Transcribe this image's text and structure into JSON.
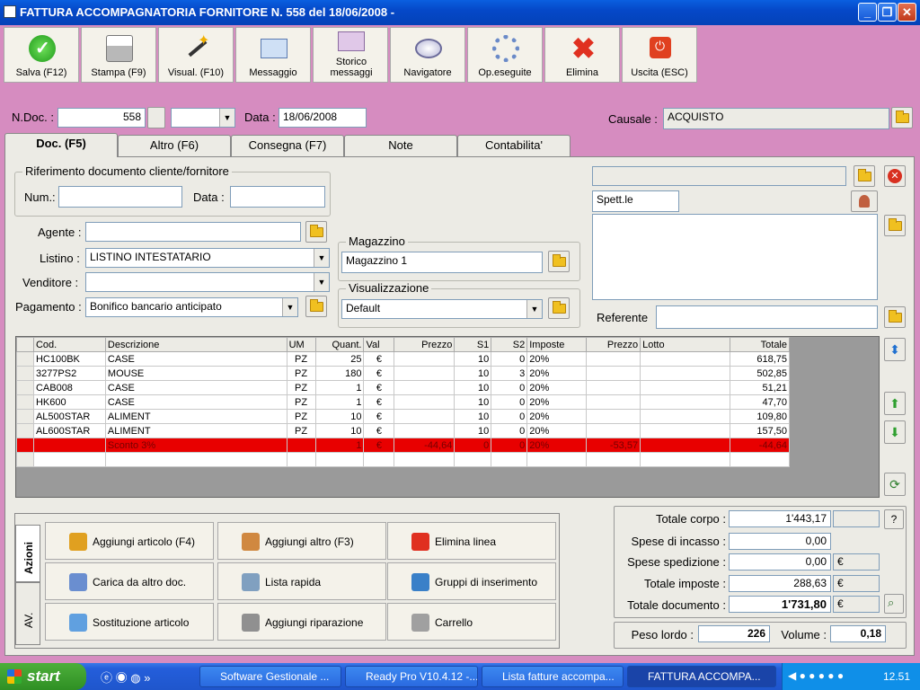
{
  "window": {
    "title": "FATTURA ACCOMPAGNATORIA FORNITORE N. 558  del 18/06/2008 - "
  },
  "toolbar": [
    {
      "label": "Salva (F12)",
      "icon": "save-icon"
    },
    {
      "label": "Stampa (F9)",
      "icon": "printer-icon"
    },
    {
      "label": "Visual. (F10)",
      "icon": "magic-wand-icon"
    },
    {
      "label": "Messaggio",
      "icon": "envelope-pen-icon"
    },
    {
      "label": "Storico messaggi",
      "icon": "envelope-search-icon"
    },
    {
      "label": "Navigatore",
      "icon": "compass-icon"
    },
    {
      "label": "Op.eseguite",
      "icon": "gears-icon"
    },
    {
      "label": "Elimina",
      "icon": "red-x-icon"
    },
    {
      "label": "Uscita (ESC)",
      "icon": "power-icon"
    }
  ],
  "header": {
    "ndoc_label": "N.Doc. :",
    "ndoc_value": "558",
    "data_label": "Data :",
    "data_value": "18/06/2008",
    "causale_label": "Causale :",
    "causale_value": "ACQUISTO"
  },
  "tabs": [
    "Doc. (F5)",
    "Altro (F6)",
    "Consegna (F7)",
    "Note",
    "Contabilita'"
  ],
  "rif": {
    "title": "Riferimento documento cliente/fornitore",
    "num_label": "Num.:",
    "data_label": "Data :"
  },
  "form": {
    "agente_label": "Agente :",
    "listino_label": "Listino :",
    "listino_value": "LISTINO INTESTATARIO",
    "venditore_label": "Venditore :",
    "pagamento_label": "Pagamento :",
    "pagamento_value": "Bonifico bancario anticipato"
  },
  "magazzino": {
    "title": "Magazzino",
    "value": "Magazzino 1"
  },
  "visualizzazione": {
    "title": "Visualizzazione",
    "value": "Default"
  },
  "destinatario": {
    "spett": "Spett.le",
    "referente_label": "Referente"
  },
  "grid": {
    "headers": [
      "Cod.",
      "Descrizione",
      "UM",
      "Quant.",
      "Val",
      "Prezzo",
      "S1",
      "S2",
      "Imposte",
      "Prezzo",
      "Lotto",
      "Totale"
    ],
    "rows": [
      [
        "HC100BK",
        "CASE",
        "PZ",
        "25",
        "€",
        "",
        "10",
        "0",
        "20%",
        "",
        "",
        "618,75"
      ],
      [
        "3277PS2",
        "MOUSE",
        "PZ",
        "180",
        "€",
        "",
        "10",
        "3",
        "20%",
        "",
        "",
        "502,85"
      ],
      [
        "CAB008",
        "CASE",
        "PZ",
        "1",
        "€",
        "",
        "10",
        "0",
        "20%",
        "",
        "",
        "51,21"
      ],
      [
        "HK600",
        "CASE",
        "PZ",
        "1",
        "€",
        "",
        "10",
        "0",
        "20%",
        "",
        "",
        "47,70"
      ],
      [
        "AL500STAR",
        "ALIMENT",
        "PZ",
        "10",
        "€",
        "",
        "10",
        "0",
        "20%",
        "",
        "",
        "109,80"
      ],
      [
        "AL600STAR",
        "ALIMENT",
        "PZ",
        "10",
        "€",
        "",
        "10",
        "0",
        "20%",
        "",
        "",
        "157,50"
      ]
    ],
    "discount_row": [
      "",
      "Sconto 3%",
      "",
      "1",
      "€",
      "-44,64",
      "0",
      "0",
      "20%",
      "-53,57",
      "",
      "-44,64"
    ]
  },
  "actions": {
    "vtabs": [
      "Azioni",
      "AV."
    ],
    "buttons": [
      {
        "label": "Aggiungi articolo (F4)",
        "icon": "add-article-icon",
        "color": "#e0a020"
      },
      {
        "label": "Aggiungi altro (F3)",
        "icon": "add-other-icon",
        "color": "#d08840"
      },
      {
        "label": "Elimina linea",
        "icon": "delete-line-icon",
        "color": "#e03020"
      },
      {
        "label": "Carica da altro doc.",
        "icon": "load-doc-icon",
        "color": "#6a8ed0"
      },
      {
        "label": "Lista rapida",
        "icon": "quick-list-icon",
        "color": "#80a0c0"
      },
      {
        "label": "Gruppi di inserimento",
        "icon": "insert-groups-icon",
        "color": "#3a80c8"
      },
      {
        "label": "Sostituzione articolo",
        "icon": "replace-article-icon",
        "color": "#60a0e0"
      },
      {
        "label": "Aggiungi riparazione",
        "icon": "wrench-icon",
        "color": "#909090"
      },
      {
        "label": "Carrello",
        "icon": "cart-icon",
        "color": "#a0a0a0"
      }
    ]
  },
  "totals": {
    "corpo_label": "Totale corpo :",
    "corpo_value": "1'443,17",
    "incasso_label": "Spese di incasso :",
    "incasso_value": "0,00",
    "spedizione_label": "Spese spedizione :",
    "spedizione_value": "0,00",
    "imposte_label": "Totale imposte :",
    "imposte_value": "288,63",
    "documento_label": "Totale documento :",
    "documento_value": "1'731,80",
    "currency": "€",
    "help": "?",
    "peso_label": "Peso lordo :",
    "peso_value": "226",
    "volume_label": "Volume :",
    "volume_value": "0,18"
  },
  "taskbar": {
    "start": "start",
    "tasks": [
      "Software Gestionale ...",
      "Ready Pro V10.4.12 -...",
      "Lista fatture accompa...",
      "FATTURA ACCOMPA..."
    ],
    "clock": "12.51"
  }
}
